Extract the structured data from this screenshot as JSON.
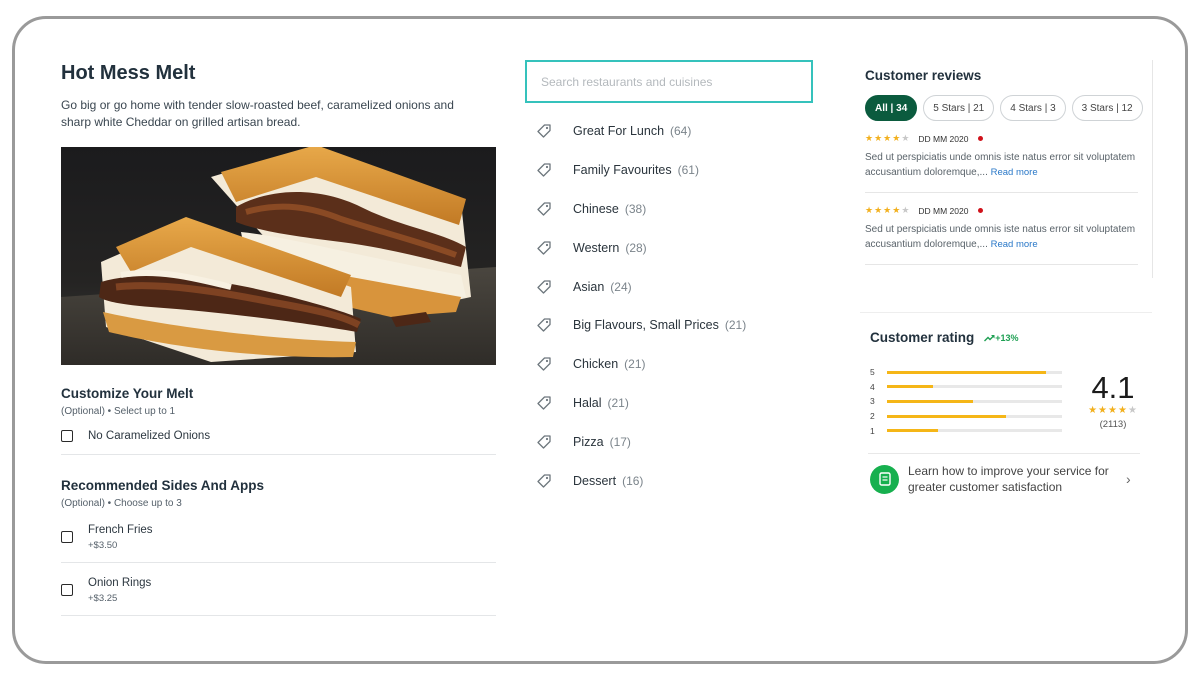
{
  "item": {
    "title": "Hot Mess Melt",
    "description": "Go big or go home with tender slow-roasted beef, caramelized onions and sharp white Cheddar on grilled artisan bread."
  },
  "customize": {
    "title": "Customize Your Melt",
    "subtitle": "(Optional) • Select up to 1",
    "options": [
      {
        "label": "No Caramelized Onions"
      }
    ]
  },
  "sides": {
    "title": "Recommended Sides And Apps",
    "subtitle": "(Optional) • Choose up to 3",
    "options": [
      {
        "label": "French Fries",
        "price": "+$3.50"
      },
      {
        "label": "Onion Rings",
        "price": "+$3.25"
      }
    ]
  },
  "search": {
    "placeholder": "Search restaurants and cuisines",
    "value": ""
  },
  "categories": [
    {
      "name": "Great For Lunch",
      "count": "(64)"
    },
    {
      "name": "Family Favourites",
      "count": "(61)"
    },
    {
      "name": "Chinese",
      "count": "(38)"
    },
    {
      "name": "Western",
      "count": "(28)"
    },
    {
      "name": "Asian",
      "count": "(24)"
    },
    {
      "name": "Big Flavours, Small Prices",
      "count": "(21)"
    },
    {
      "name": "Chicken",
      "count": "(21)"
    },
    {
      "name": "Halal",
      "count": "(21)"
    },
    {
      "name": "Pizza",
      "count": "(17)"
    },
    {
      "name": "Dessert",
      "count": "(16)"
    }
  ],
  "reviews": {
    "title": "Customer reviews",
    "filters": [
      {
        "label": "All | 34",
        "active": true
      },
      {
        "label": "5 Stars | 21",
        "active": false
      },
      {
        "label": "4 Stars | 3",
        "active": false
      },
      {
        "label": "3 Stars | 12",
        "active": false
      }
    ],
    "items": [
      {
        "stars": 4,
        "date": "DD MM 2020",
        "text": "Sed ut perspiciatis unde omnis iste natus error sit voluptatem accusantium doloremque,...",
        "read_more": "Read more"
      },
      {
        "stars": 4,
        "date": "DD MM 2020",
        "text": "Sed ut perspiciatis unde omnis iste natus error sit voluptatem accusantium doloremque,...",
        "read_more": "Read more"
      }
    ]
  },
  "rating": {
    "title": "Customer rating",
    "trend": "+13%",
    "distribution": [
      {
        "label": "5",
        "fraction": 0.91
      },
      {
        "label": "4",
        "fraction": 0.26
      },
      {
        "label": "3",
        "fraction": 0.49
      },
      {
        "label": "2",
        "fraction": 0.68
      },
      {
        "label": "1",
        "fraction": 0.29
      }
    ],
    "score": "4.1",
    "score_stars": 4,
    "count": "(2113)",
    "learn_text": "Learn how to improve your service for greater customer satisfaction"
  },
  "colors": {
    "accent_teal": "#35c2bc",
    "pill_active": "#0b5b3e",
    "star": "#f2b01e",
    "bar": "#f5b617",
    "trend_green": "#1ea053",
    "link_blue": "#2a78c8",
    "alert_red": "#d0121b"
  },
  "icons": {
    "category": "tag-icon",
    "trend": "trend-up-icon",
    "learn": "document-icon",
    "learn_arrow": "chevron-right-icon"
  }
}
